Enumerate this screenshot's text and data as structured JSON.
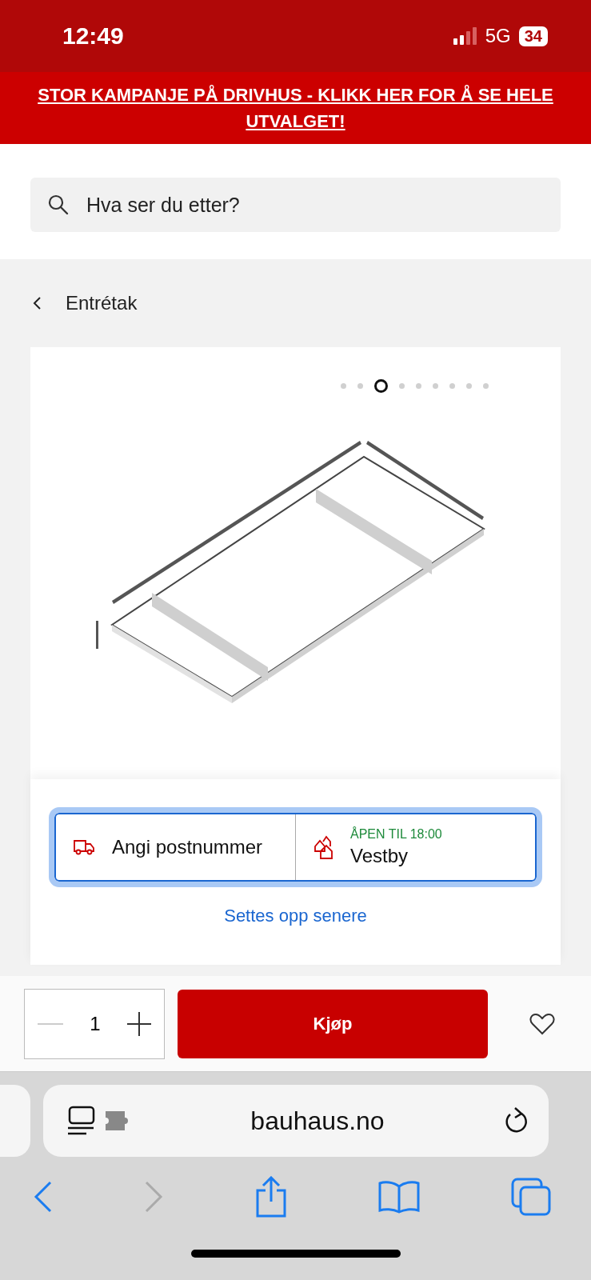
{
  "status_bar": {
    "time": "12:49",
    "network": "5G",
    "battery": "34"
  },
  "banner": {
    "text": "STOR KAMPANJE PÅ DRIVHUS - KLIKK HER FOR Å SE HELE UTVALGET!"
  },
  "search": {
    "placeholder": "Hva ser du etter?"
  },
  "breadcrumb": {
    "label": "Entrétak"
  },
  "gallery": {
    "dots": [
      {
        "selected": false
      },
      {
        "selected": false
      },
      {
        "selected": true
      },
      {
        "selected": false
      },
      {
        "selected": false
      },
      {
        "selected": false
      },
      {
        "selected": false
      },
      {
        "selected": false
      },
      {
        "selected": false
      }
    ]
  },
  "delivery": {
    "postcode": "Angi postnummer",
    "store_status": "ÅPEN TIL 18:00",
    "store": "Vestby",
    "assembly_link": "Settes opp senere"
  },
  "purchase": {
    "quantity": "1",
    "buy": "Kjøp"
  },
  "browser": {
    "url": "bauhaus.no",
    "back_disabled": false,
    "forward_disabled": true
  }
}
